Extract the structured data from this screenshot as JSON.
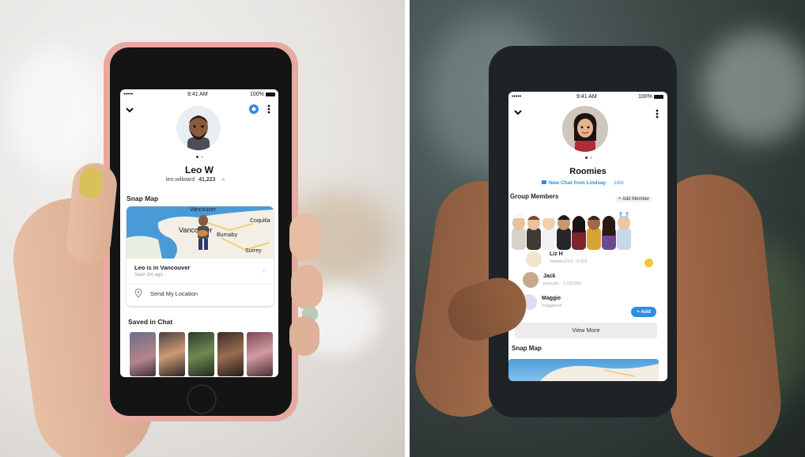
{
  "left_phone": {
    "status": {
      "carrier": "•••••",
      "time": "9:41 AM",
      "battery": "100%"
    },
    "profile": {
      "name": "Leo W",
      "username": "leo.willward",
      "score": "41,223"
    },
    "snap_map": {
      "title": "Snap Map",
      "places": [
        "Vancouver",
        "Vancouver",
        "Coquitla",
        "Burnaby",
        "Surrey"
      ],
      "location_title": "Leo is in Vancouver",
      "location_sub": "Seen 2m ago",
      "send_location": "Send My Location"
    },
    "saved_in_chat": {
      "title": "Saved in Chat"
    }
  },
  "right_phone": {
    "status": {
      "carrier": "•••••",
      "time": "9:41 AM",
      "battery": "100%"
    },
    "group": {
      "name": "Roomies",
      "new_chat": "New Chat from Lindsay",
      "new_chat_time": "10m"
    },
    "members_section": {
      "title": "Group Members",
      "add_member": "Add Member",
      "members": [
        {
          "name": "Liz H",
          "sub": "hawkins213 · 4,322"
        },
        {
          "name": "Jack",
          "sub": "jackcats · 1,032,001"
        },
        {
          "name": "Maggie",
          "sub": "maggienel"
        }
      ],
      "add_button": "+ Add",
      "view_more": "View More"
    },
    "snap_map": {
      "title": "Snap Map"
    }
  },
  "colors": {
    "snap_blue": "#2f8ce5",
    "pink_case": "#e9a8a2",
    "dark_case": "#1e2426"
  },
  "icons": [
    "chevron-down-icon",
    "bitmoji-avatar",
    "more-dots-icon",
    "location-pin-icon",
    "chat-bubble-icon",
    "plus-icon",
    "heart-eyes-emoji"
  ]
}
